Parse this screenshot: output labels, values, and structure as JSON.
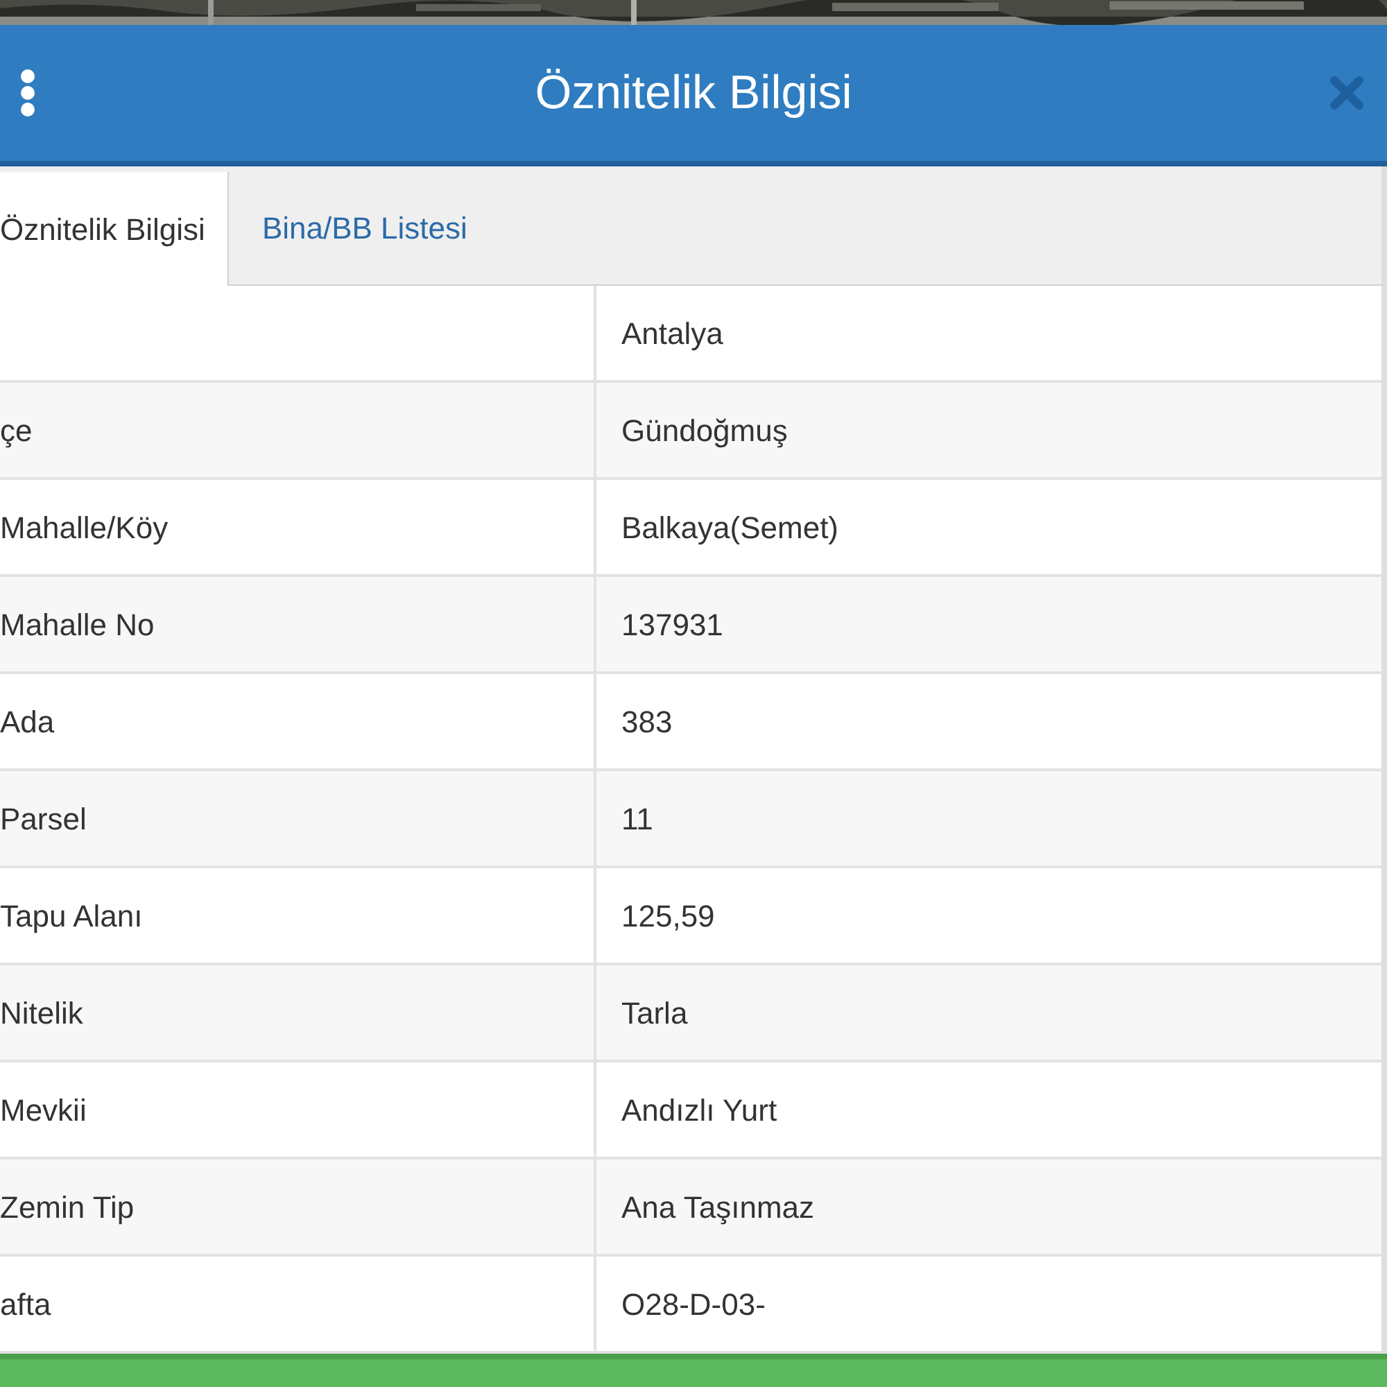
{
  "header": {
    "title": "Öznitelik Bilgisi"
  },
  "tabs": [
    {
      "label": "Öznitelik Bilgisi",
      "selected": true
    },
    {
      "label": "Bina/BB Listesi",
      "selected": false
    }
  ],
  "rows": [
    {
      "value": "Antalya"
    },
    {
      "label": "çe",
      "value": "Gündoğmuş"
    },
    {
      "label": "Mahalle/Köy",
      "value": "Balkaya(Semet)"
    },
    {
      "label": "Mahalle No",
      "value": "137931"
    },
    {
      "label": "Ada",
      "value": "383"
    },
    {
      "label": "Parsel",
      "value": "11"
    },
    {
      "label": "Tapu Alanı",
      "value": "125,59"
    },
    {
      "label": "Nitelik",
      "value": "Tarla"
    },
    {
      "label": "Mevkii",
      "value": "Andızlı Yurt"
    },
    {
      "label": "Zemin Tip",
      "value": "Ana Taşınmaz"
    },
    {
      "label": "afta",
      "value": "O28-D-03-"
    }
  ]
}
